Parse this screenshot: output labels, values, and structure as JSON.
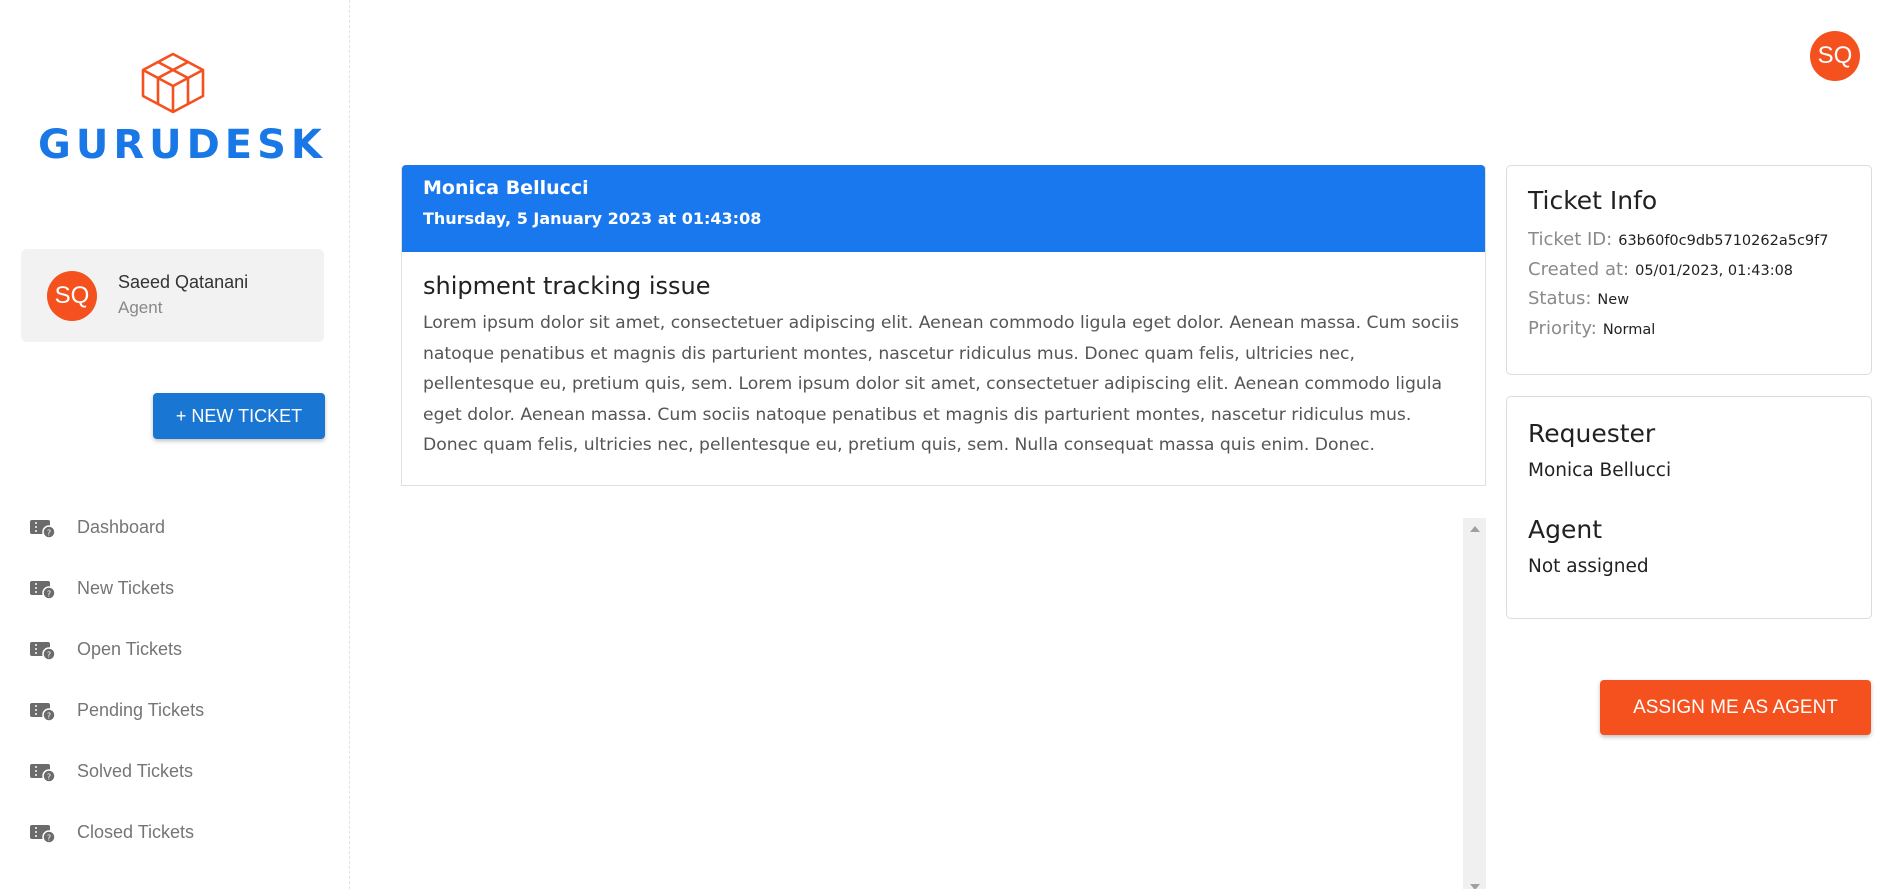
{
  "brand": {
    "name": "GURUDESK",
    "logo_icon": "cube-icon",
    "color": "#1a78e6",
    "icon_color": "#f4511e"
  },
  "user": {
    "initials": "SQ",
    "name": "Saeed Qatanani",
    "role": "Agent",
    "avatar_color": "#f4511e"
  },
  "sidebar": {
    "new_ticket_label": "+ NEW TICKET",
    "items": [
      {
        "label": "Dashboard",
        "icon": "ticket-icon"
      },
      {
        "label": "New Tickets",
        "icon": "ticket-icon"
      },
      {
        "label": "Open Tickets",
        "icon": "ticket-icon"
      },
      {
        "label": "Pending Tickets",
        "icon": "ticket-icon"
      },
      {
        "label": "Solved Tickets",
        "icon": "ticket-icon"
      },
      {
        "label": "Closed Tickets",
        "icon": "ticket-icon"
      }
    ]
  },
  "header": {
    "avatar_initials": "SQ"
  },
  "ticket": {
    "author": "Monica Bellucci",
    "date": "Thursday, 5 January 2023 at 01:43:08",
    "subject": "shipment tracking issue",
    "message": "Lorem ipsum dolor sit amet, consectetuer adipiscing elit. Aenean commodo ligula eget dolor. Aenean massa. Cum sociis natoque penatibus et magnis dis parturient montes, nascetur ridiculus mus. Donec quam felis, ultricies nec, pellentesque eu, pretium quis, sem. Lorem ipsum dolor sit amet, consectetuer adipiscing elit. Aenean commodo ligula eget dolor. Aenean massa. Cum sociis natoque penatibus et magnis dis parturient montes, nascetur ridiculus mus. Donec quam felis, ultricies nec, pellentesque eu, pretium quis, sem. Nulla consequat massa quis enim. Donec.",
    "header_color": "#1a78ef"
  },
  "ticket_info": {
    "title": "Ticket Info",
    "id_label": "Ticket ID:",
    "id_value": "63b60f0c9db5710262a5c9f7",
    "created_label": "Created at:",
    "created_value": "05/01/2023, 01:43:08",
    "status_label": "Status:",
    "status_value": "New",
    "priority_label": "Priority:",
    "priority_value": "Normal"
  },
  "requester": {
    "title": "Requester",
    "name": "Monica Bellucci"
  },
  "agent": {
    "title": "Agent",
    "value": "Not assigned"
  },
  "actions": {
    "assign_label": "ASSIGN ME AS AGENT",
    "assign_color": "#f4511e"
  }
}
